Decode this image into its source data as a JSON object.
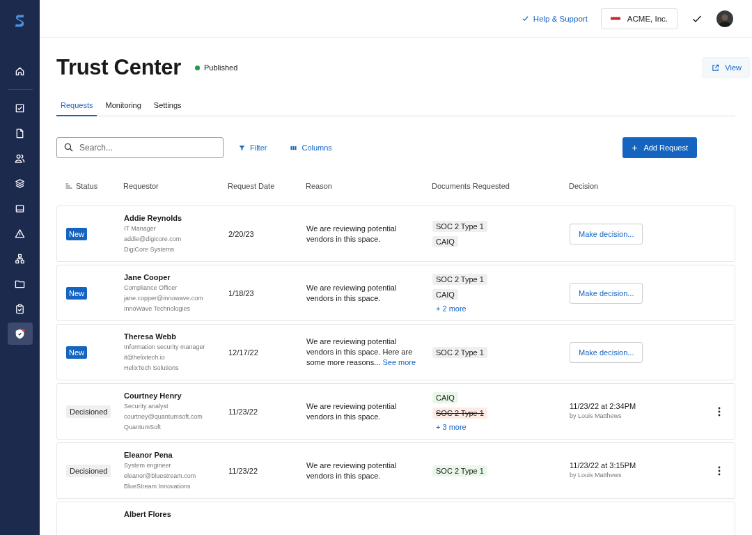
{
  "sidebar": {
    "items": [
      {
        "selected": false
      },
      {
        "selected": false
      },
      {
        "selected": false
      },
      {
        "selected": false
      },
      {
        "selected": false
      },
      {
        "selected": false
      },
      {
        "selected": false
      },
      {
        "selected": false
      },
      {
        "selected": false
      },
      {
        "selected": false
      },
      {
        "selected": true
      }
    ]
  },
  "topbar": {
    "help_link": "Help & Support",
    "org": "ACME, Inc."
  },
  "page": {
    "title": "Trust Center",
    "status": "Published",
    "view_button": "View"
  },
  "tabs": [
    {
      "label": "Requests",
      "selected": true
    },
    {
      "label": "Monitoring",
      "selected": false
    },
    {
      "label": "Settings",
      "selected": false
    }
  ],
  "toolbar": {
    "search": {
      "placeholder": "Search..."
    },
    "filter": "Filter",
    "columns": "Columns",
    "add_button": "Add Request"
  },
  "table": {
    "columns": [
      "Status",
      "Requestor",
      "Request Date",
      "Reason",
      "Documents Requested",
      "Decision"
    ],
    "rows": [
      {
        "status": {
          "label": "New",
          "kind": "new"
        },
        "name": "Addie Reynolds",
        "title": "IT Manager",
        "email": "addie@digicore.com",
        "company": "DigiCore Systems",
        "date": "2/20/23",
        "reason": "We are reviewing potential vendors in this space.",
        "documents": [
          {
            "label": "SOC 2 Type 1",
            "kind": "pending"
          },
          {
            "label": "CAIQ",
            "kind": "pending"
          }
        ],
        "decision": {
          "kind": "button",
          "label": "Make decision..."
        }
      },
      {
        "status": {
          "label": "New",
          "kind": "new"
        },
        "name": "Jane Cooper",
        "title": "Compliance Officer",
        "email": "jane.copper@innowave.com",
        "company": "InnoWave Technologies",
        "date": "1/18/23",
        "reason": "We are reviewing potential vendors in this space.",
        "documents": [
          {
            "label": "SOC 2 Type 1",
            "kind": "pending"
          },
          {
            "label": "CAIQ",
            "kind": "pending"
          }
        ],
        "more": "+ 2 more",
        "decision": {
          "kind": "button",
          "label": "Make decision..."
        }
      },
      {
        "status": {
          "label": "New",
          "kind": "new"
        },
        "name": "Theresa Webb",
        "title": "Information security manager",
        "email": "it@helixtech.io",
        "company": "HelixTech Solutions",
        "date": "12/17/22",
        "reason": "We are reviewing potential vendors in this space. Here are some more reasons...",
        "reason_link": "See more",
        "documents": [
          {
            "label": "SOC 2 Type 1",
            "kind": "pending"
          }
        ],
        "decision": {
          "kind": "button",
          "label": "Make decision..."
        }
      },
      {
        "status": {
          "label": "Decisioned",
          "kind": "decisioned"
        },
        "name": "Courtney Henry",
        "title": "Security analyst",
        "email": "courtney@quantumsoft.com",
        "company": "QuantumSoft",
        "date": "11/23/22",
        "reason": "We are reviewing potential vendors in this space.",
        "documents": [
          {
            "label": "CAIQ",
            "kind": "approved"
          },
          {
            "label": "SOC 2 Type 1",
            "kind": "denied"
          }
        ],
        "more": "+ 3 more",
        "decision": {
          "kind": "decided",
          "when": "11/23/22 at 2:34PM",
          "by": "by Louis Matthews"
        }
      },
      {
        "status": {
          "label": "Decisioned",
          "kind": "decisioned"
        },
        "name": "Eleanor Pena",
        "title": "System engineer",
        "email": "eleanor@bluestream.com",
        "company": "BlueStream Innovations",
        "date": "11/23/22",
        "reason": "We are reviewing potential vendors in this space.",
        "documents": [
          {
            "label": "SOC 2 Type 1",
            "kind": "approved"
          }
        ],
        "decision": {
          "kind": "decided",
          "when": "11/23/22 at 3:15PM",
          "by": "by Louis Matthews"
        }
      },
      {
        "name": "Albert Flores"
      }
    ]
  }
}
